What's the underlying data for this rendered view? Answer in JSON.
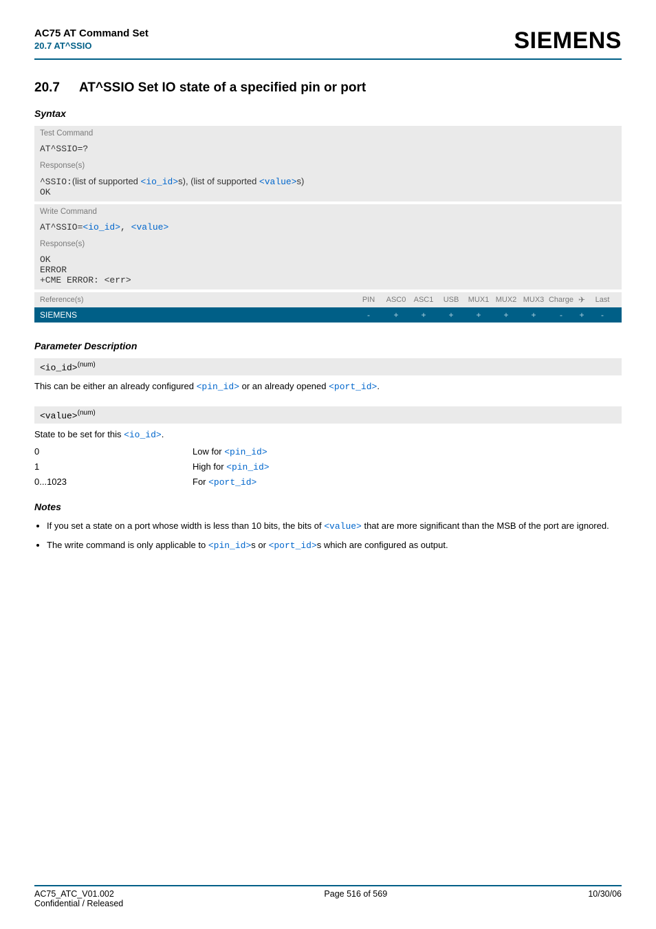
{
  "header": {
    "title": "AC75 AT Command Set",
    "subtitle": "20.7 AT^SSIO",
    "brand": "SIEMENS"
  },
  "section": {
    "number": "20.7",
    "title": "AT^SSIO   Set IO state of a specified pin or port"
  },
  "syntax": {
    "label": "Syntax",
    "test_cmd_label": "Test Command",
    "test_cmd": "AT^SSIO=?",
    "response_label": "Response(s)",
    "test_resp_prefix": "^SSIO:",
    "test_resp_mid1": "(list of supported ",
    "test_resp_io": "<io_id>",
    "test_resp_mid2": "s), (list of supported ",
    "test_resp_val": "<value>",
    "test_resp_end": "s)",
    "ok": "OK",
    "write_cmd_label": "Write Command",
    "write_cmd_prefix": "AT^SSIO=",
    "write_cmd_io": "<io_id>",
    "write_cmd_sep": ", ",
    "write_cmd_val": "<value>",
    "error": "ERROR",
    "cme": "+CME ERROR: <err>",
    "ref_label": "Reference(s)",
    "cols": [
      "PIN",
      "ASC0",
      "ASC1",
      "USB",
      "MUX1",
      "MUX2",
      "MUX3",
      "Charge",
      "✈",
      "Last"
    ],
    "vendor": "SIEMENS",
    "syms": [
      "-",
      "+",
      "+",
      "+",
      "+",
      "+",
      "+",
      "-",
      "+",
      "-"
    ]
  },
  "params": {
    "label": "Parameter Description",
    "io_id": "<io_id>",
    "num": "(num)",
    "io_text1": "This can be either an already configured ",
    "pin_id": "<pin_id>",
    "io_text2": " or an already opened ",
    "port_id": "<port_id>",
    "io_text3": ".",
    "value": "<value>",
    "state_text1": "State to be set for this ",
    "state_text2": ".",
    "rows": [
      {
        "k": "0",
        "pre": "Low for ",
        "ref": "<pin_id>"
      },
      {
        "k": "1",
        "pre": "High for ",
        "ref": "<pin_id>"
      },
      {
        "k": "0...1023",
        "pre": "For ",
        "ref": "<port_id>"
      }
    ]
  },
  "notes": {
    "label": "Notes",
    "n1a": "If you set a state on a port whose width is less than 10 bits, the bits of ",
    "n1b": "<value>",
    "n1c": " that are more significant than the MSB of the port are ignored.",
    "n2a": "The write command is only applicable to ",
    "n2b": "<pin_id>",
    "n2c": "s or ",
    "n2d": "<port_id>",
    "n2e": "s which are configured as output."
  },
  "footer": {
    "left1": "AC75_ATC_V01.002",
    "left2": "Confidential / Released",
    "center": "Page 516 of 569",
    "right": "10/30/06"
  }
}
